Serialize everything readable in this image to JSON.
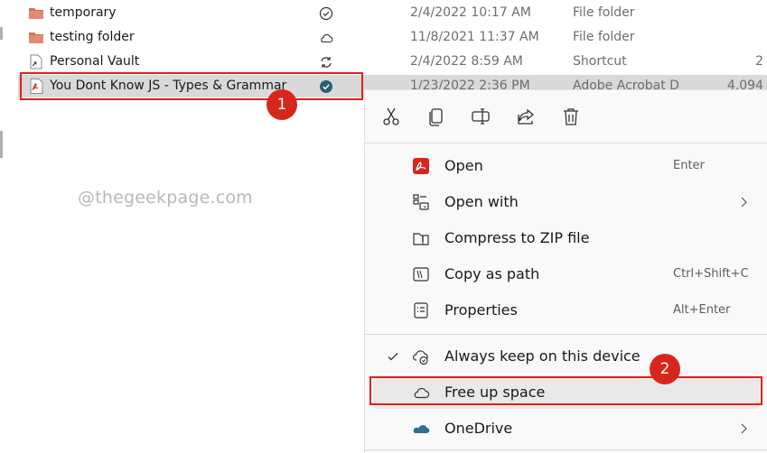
{
  "files": [
    {
      "name": "temporary",
      "date": "2/4/2022 10:17 AM",
      "type": "File folder",
      "size": "",
      "icon": "folder-icon",
      "status": "check-circle-icon"
    },
    {
      "name": "testing folder",
      "date": "11/8/2021 11:37 AM",
      "type": "File folder",
      "size": "",
      "icon": "folder-icon",
      "status": "cloud-icon"
    },
    {
      "name": "Personal Vault",
      "date": "2/4/2022 8:59 AM",
      "type": "Shortcut",
      "size": "2",
      "icon": "shortcut-icon",
      "status": "sync-icon"
    },
    {
      "name": "You Dont Know JS - Types & Grammar",
      "date": "1/23/2022 2:36 PM",
      "type": "Adobe Acrobat D",
      "size": "4,094",
      "icon": "pdf-icon",
      "status": "filled-check-circle-icon"
    }
  ],
  "watermark": "@thegeekpage.com",
  "badges": {
    "first": "1",
    "second": "2"
  },
  "quick_actions": [
    {
      "name": "cut-icon"
    },
    {
      "name": "copy-icon"
    },
    {
      "name": "rename-icon"
    },
    {
      "name": "share-icon"
    },
    {
      "name": "delete-icon"
    }
  ],
  "menu": {
    "open": {
      "label": "Open",
      "shortcut": "Enter"
    },
    "open_with": {
      "label": "Open with"
    },
    "compress": {
      "label": "Compress to ZIP file"
    },
    "copy_path": {
      "label": "Copy as path",
      "shortcut": "Ctrl+Shift+C"
    },
    "properties": {
      "label": "Properties",
      "shortcut": "Alt+Enter"
    },
    "always_keep": {
      "label": "Always keep on this device"
    },
    "free_up": {
      "label": "Free up space"
    },
    "onedrive": {
      "label": "OneDrive"
    }
  },
  "colors": {
    "accent_red": "#e0201b",
    "pdf_red": "#d7261f",
    "folder": "#d4705b"
  }
}
